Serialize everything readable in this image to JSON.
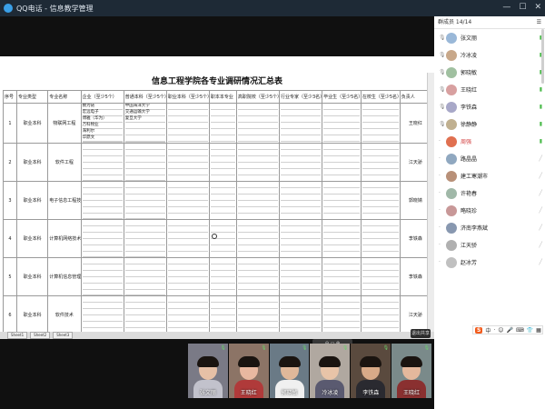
{
  "window": {
    "title": "QQ电话 - 信息教学管理"
  },
  "spreadsheet": {
    "title": "信息工程学院各专业调研情况汇总表",
    "headers": [
      "序号",
      "专业类型",
      "专业名称",
      "企业（至少5个）",
      "普通本科（至少5个）",
      "职业本科（至少5个）",
      "职本本专业",
      "高职院校（至少5个）",
      "行业专家（至少3名）",
      "毕业生（至少5名）",
      "在校生（至少5名）",
      "负责人"
    ],
    "rows": [
      {
        "no": "1",
        "type": "职业本科",
        "name": "物联网工程",
        "enterprises": [
          "数为链",
          "宏远电子",
          "博雅（华为）",
          "万科物业",
          "海利尔",
          "华鼎文"
        ],
        "universities": [
          "中国海洋大学",
          "交通运输大学",
          "复旦大学"
        ],
        "owner": "王晓红"
      },
      {
        "no": "2",
        "type": "职业本科",
        "name": "软件工程",
        "enterprises": [],
        "universities": [],
        "owner": "江天骄"
      },
      {
        "no": "3",
        "type": "职业本科",
        "name": "电子信息工程技术",
        "enterprises": [],
        "universities": [],
        "owner": "郭晓婧"
      },
      {
        "no": "4",
        "type": "职业本科",
        "name": "计算机网络技术",
        "enterprises": [],
        "universities": [],
        "owner": "李铁森"
      },
      {
        "no": "5",
        "type": "职业本科",
        "name": "计算机信息管理",
        "enterprises": [],
        "universities": [],
        "owner": "李铁森"
      },
      {
        "no": "6",
        "type": "职业本科",
        "name": "软件技术",
        "enterprises": [],
        "universities": [],
        "owner": "江天骄"
      }
    ],
    "sheet_tabs": [
      "Sheet1",
      "Sheet2",
      "Sheet3"
    ]
  },
  "screen_toolbar": {
    "zoom_label": "⊖ ▭ ⊕",
    "exit_label": "退出共享"
  },
  "members_panel": {
    "header": "群成员 14/14",
    "members": [
      {
        "name": "张文丽",
        "status": "on",
        "color": "#9ab8d8"
      },
      {
        "name": "冷冰凌",
        "status": "on",
        "color": "#c8a88a"
      },
      {
        "name": "郭晓敏",
        "status": "on",
        "color": "#a0c0a0"
      },
      {
        "name": "王晓红",
        "status": "on",
        "color": "#d8a0a0"
      },
      {
        "name": "李铁森",
        "status": "on",
        "color": "#a8a8c8"
      },
      {
        "name": "徐静静",
        "status": "on",
        "color": "#c0b090"
      },
      {
        "name": "周强",
        "status": "speaking",
        "color": "#e07050"
      },
      {
        "name": "路晶晶",
        "status": "off",
        "color": "#90a8c0"
      },
      {
        "name": "建工寒潮市",
        "status": "off",
        "color": "#b89078"
      },
      {
        "name": "许艳春",
        "status": "off",
        "color": "#a0b8a8"
      },
      {
        "name": "略晓珍",
        "status": "off",
        "color": "#c89898"
      },
      {
        "name": "济南李燕斌",
        "status": "off",
        "color": "#8898b0"
      },
      {
        "name": "江天骄",
        "status": "off",
        "color": "#b0b0b0"
      },
      {
        "name": "赵冰芳",
        "status": "off",
        "color": "#c0c0c0"
      }
    ]
  },
  "ime": {
    "logo": "S",
    "lang": "中"
  },
  "videos": [
    {
      "name": "张文丽",
      "bg": "#7a7a86",
      "skin": "#e6c0a6",
      "shirt": "#c2c2cc"
    },
    {
      "name": "王晓红",
      "bg": "#8c7466",
      "skin": "#e8b8a0",
      "shirt": "#b03a3a"
    },
    {
      "name": "郭晓敏",
      "bg": "#6a7a86",
      "skin": "#e0b89a",
      "shirt": "#f0f0f0"
    },
    {
      "name": "冷冰凌",
      "bg": "#b0a8a0",
      "skin": "#e8c4a8",
      "shirt": "#5a5a70"
    },
    {
      "name": "李铁森",
      "bg": "#5a4a3e",
      "skin": "#d8aa88",
      "shirt": "#2a2a30"
    },
    {
      "name": "王晓红",
      "bg": "#7a8a8a",
      "skin": "#e4b89c",
      "shirt": "#8a3030"
    }
  ]
}
